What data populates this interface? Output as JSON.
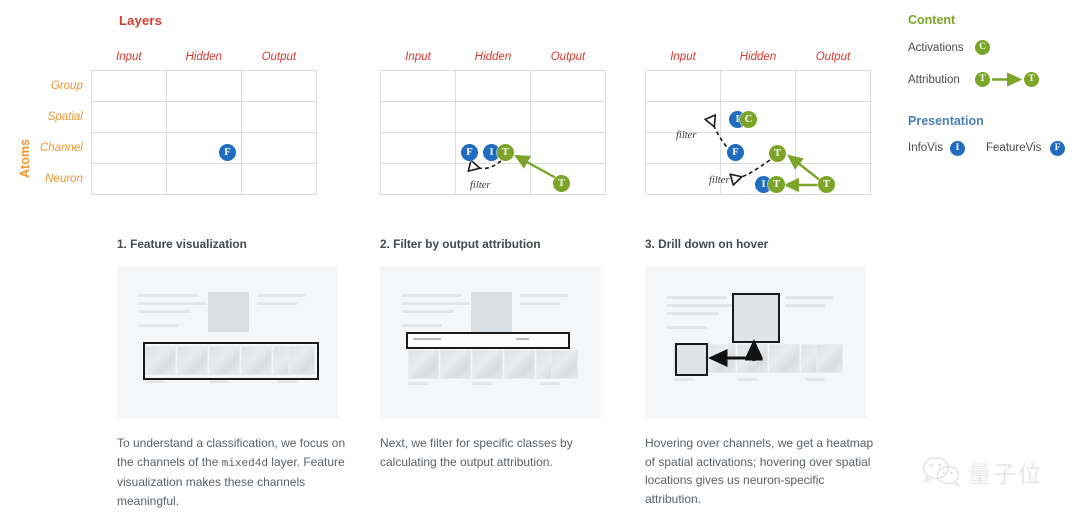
{
  "matrix": {
    "title": "Layers",
    "axis_label": "Atoms",
    "columns": [
      "Input",
      "Hidden",
      "Output"
    ],
    "rows": [
      "Group",
      "Spatial",
      "Channel",
      "Neuron"
    ],
    "filter_label": "filter"
  },
  "panels": [
    {
      "badges": [
        {
          "letter": "F",
          "color": "blue",
          "row": "Channel",
          "col": "Hidden"
        }
      ]
    },
    {
      "badges": [
        {
          "letter": "F",
          "color": "blue"
        },
        {
          "letter": "I",
          "color": "blue"
        },
        {
          "letter": "T",
          "color": "green"
        },
        {
          "letter": "T",
          "color": "green"
        }
      ]
    },
    {
      "badges": [
        {
          "letter": "I",
          "color": "blue"
        },
        {
          "letter": "C",
          "color": "green"
        },
        {
          "letter": "F",
          "color": "blue"
        },
        {
          "letter": "T",
          "color": "green"
        },
        {
          "letter": "I",
          "color": "blue"
        },
        {
          "letter": "T",
          "color": "green"
        },
        {
          "letter": "T",
          "color": "green"
        }
      ]
    }
  ],
  "legend": {
    "content_heading": "Content",
    "presentation_heading": "Presentation",
    "activations_label": "Activations",
    "activations_badge": "C",
    "attribution_label": "Attribution",
    "attribution_badge_from": "T",
    "attribution_badge_to": "T",
    "infovis_label": "InfoVis",
    "infovis_badge": "I",
    "featurevis_label": "FeatureVis",
    "featurevis_badge": "F"
  },
  "steps": [
    {
      "title": "1. Feature visualization",
      "caption_a": "To understand a classification, we focus on the channels of the ",
      "caption_mono": "mixed4d",
      "caption_b": " layer. Feature visualization makes these channels meaningful."
    },
    {
      "title": "2. Filter by output attribution",
      "caption_a": "Next, we filter for specific classes by calculating the output attribution.",
      "caption_mono": "",
      "caption_b": ""
    },
    {
      "title": "3. Drill down on hover",
      "caption_a": "Hovering over channels, we get a heatmap of spatial activations; hovering over spatial locations gives us neuron-specific attribution.",
      "caption_mono": "",
      "caption_b": ""
    }
  ],
  "watermark": {
    "text": "量子位"
  },
  "colors": {
    "blue_badge": "#1f6cc0",
    "green_badge": "#7ba428",
    "title_red": "#d63a2f",
    "axis_orange": "#f0962d",
    "presentation_blue": "#4a7fb5"
  }
}
